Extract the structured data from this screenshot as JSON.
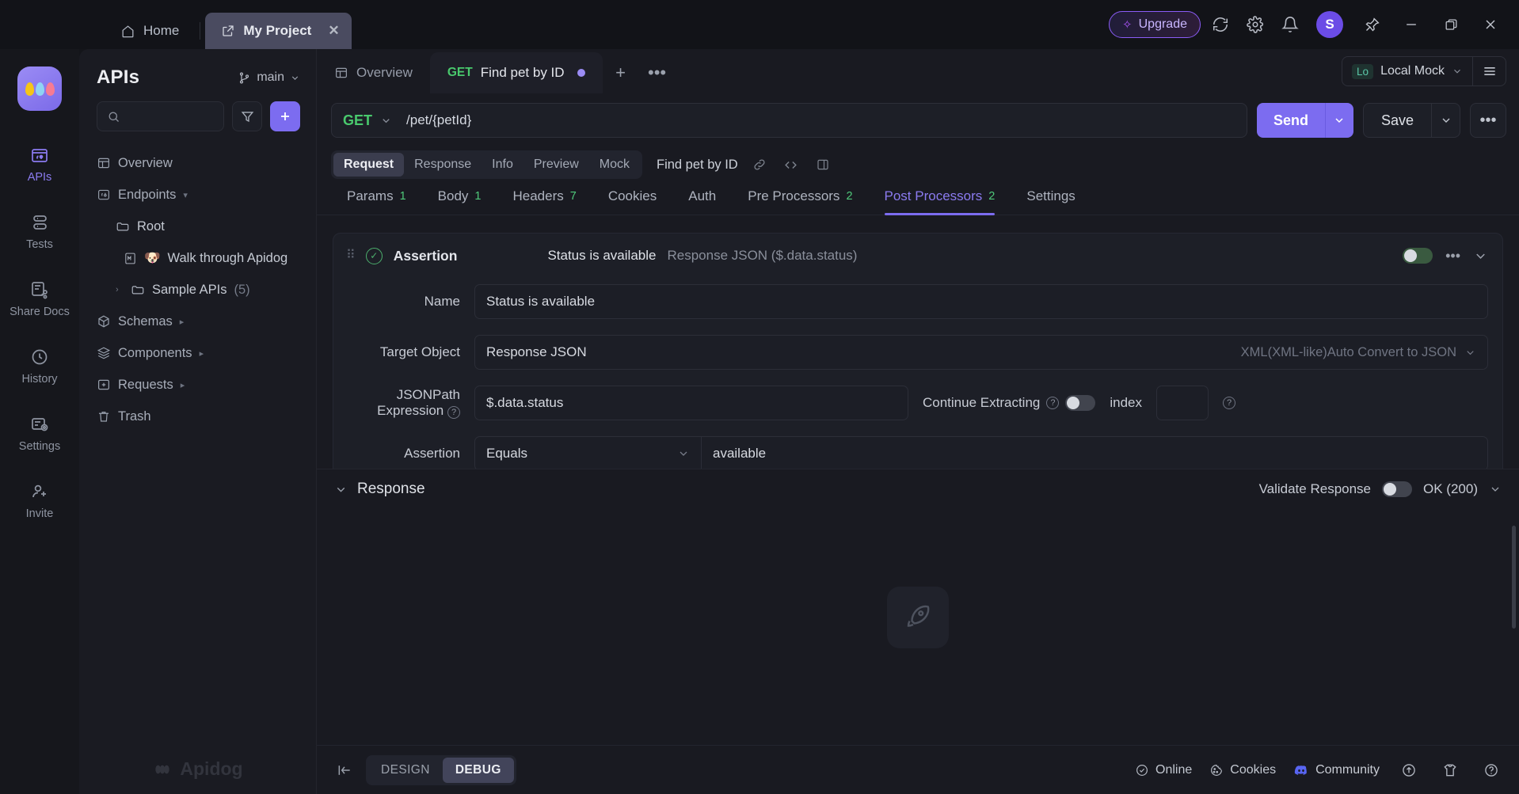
{
  "titlebar": {
    "home_tab": "Home",
    "project_tab": "My Project",
    "close_tab_label": "✕",
    "upgrade_label": "Upgrade",
    "avatar_initial": "S",
    "icons": [
      "sync-icon",
      "gear-icon",
      "bell-icon",
      "pin-icon",
      "minimize-icon",
      "maximize-icon",
      "close-icon"
    ]
  },
  "rail": {
    "items": [
      {
        "label": "APIs",
        "icon": "apis-icon",
        "active": true
      },
      {
        "label": "Tests",
        "icon": "tests-icon",
        "active": false
      },
      {
        "label": "Share Docs",
        "icon": "share-docs-icon",
        "active": false
      },
      {
        "label": "History",
        "icon": "history-icon",
        "active": false
      },
      {
        "label": "Settings",
        "icon": "settings-icon",
        "active": false
      },
      {
        "label": "Invite",
        "icon": "invite-icon",
        "active": false
      }
    ]
  },
  "sidebar": {
    "title": "APIs",
    "branch": "main",
    "search_placeholder": "",
    "watermark": "Apidog",
    "tree": [
      {
        "label": "Overview",
        "icon": "overview-icon",
        "level": 1,
        "caret": "",
        "count": ""
      },
      {
        "label": "Endpoints",
        "icon": "endpoints-icon",
        "level": 1,
        "caret": "▾",
        "count": ""
      },
      {
        "label": "Root",
        "icon": "folder-icon",
        "level": 2,
        "caret": "",
        "count": ""
      },
      {
        "label": "Walk through Apidog",
        "icon": "markdown-icon",
        "emoji": "🐶",
        "level": 3,
        "caret": "",
        "count": ""
      },
      {
        "label": "Sample APIs",
        "icon": "folder-icon",
        "level": 2,
        "caret": "›",
        "count": "(5)"
      },
      {
        "label": "Schemas",
        "icon": "schemas-icon",
        "level": 1,
        "caret": "▸",
        "count": ""
      },
      {
        "label": "Components",
        "icon": "components-icon",
        "level": 1,
        "caret": "▸",
        "count": ""
      },
      {
        "label": "Requests",
        "icon": "requests-icon",
        "level": 1,
        "caret": "▸",
        "count": ""
      },
      {
        "label": "Trash",
        "icon": "trash-icon",
        "level": 1,
        "caret": "",
        "count": ""
      }
    ]
  },
  "doctabs": {
    "overview_label": "Overview",
    "request_method": "GET",
    "request_name": "Find pet by ID",
    "add_tab_label": "+",
    "more_tabs_label": "•••",
    "env_badge": "Lo",
    "env_name": "Local Mock"
  },
  "urlbar": {
    "method": "GET",
    "url": "/pet/{petId}",
    "url_placeholder": "",
    "send_label": "Send",
    "save_label": "Save",
    "more_label": "•••"
  },
  "pills": {
    "items": [
      "Request",
      "Response",
      "Info",
      "Preview",
      "Mock"
    ],
    "active": "Request",
    "operation_name": "Find pet by ID",
    "icons": [
      "link-icon",
      "code-icon",
      "panel-icon"
    ]
  },
  "sectabs": [
    {
      "label": "Params",
      "count": "1",
      "active": false
    },
    {
      "label": "Body",
      "count": "1",
      "active": false
    },
    {
      "label": "Headers",
      "count": "7",
      "active": false
    },
    {
      "label": "Cookies",
      "count": "",
      "active": false
    },
    {
      "label": "Auth",
      "count": "",
      "active": false
    },
    {
      "label": "Pre Processors",
      "count": "2",
      "active": false
    },
    {
      "label": "Post Processors",
      "count": "2",
      "active": true
    },
    {
      "label": "Settings",
      "count": "",
      "active": false
    }
  ],
  "assertion_card": {
    "type_label": "Assertion",
    "summary_name": "Status is available",
    "summary_target": "Response JSON ($.data.status)",
    "enabled": true,
    "more_label": "•••",
    "fields": {
      "name_label": "Name",
      "name_value": "Status is available",
      "target_label": "Target Object",
      "target_value": "Response JSON",
      "target_suffix": "XML(XML-like)Auto Convert to JSON",
      "jsonpath_label": "JSONPath Expression",
      "jsonpath_value": "$.data.status",
      "continue_label": "Continue Extracting",
      "continue_on": false,
      "index_label": "index",
      "index_value": "",
      "assertion_label": "Assertion",
      "assertion_op": "Equals",
      "assertion_value": "available"
    }
  },
  "response": {
    "title": "Response",
    "validate_label": "Validate Response",
    "validate_on": false,
    "status_label": "OK (200)",
    "empty_icon": "rocket-icon"
  },
  "bottombar": {
    "collapse_icon": "collapse-left-icon",
    "modes": [
      "DESIGN",
      "DEBUG"
    ],
    "active_mode": "DEBUG",
    "online_label": "Online",
    "cookies_label": "Cookies",
    "community_label": "Community",
    "icons": [
      "upload-icon",
      "shirt-icon",
      "help-icon"
    ]
  },
  "colors": {
    "accent": "#7c6cf0",
    "method_get": "#49c96d",
    "upgrade": "#a855f7",
    "discord": "#5865f2"
  }
}
